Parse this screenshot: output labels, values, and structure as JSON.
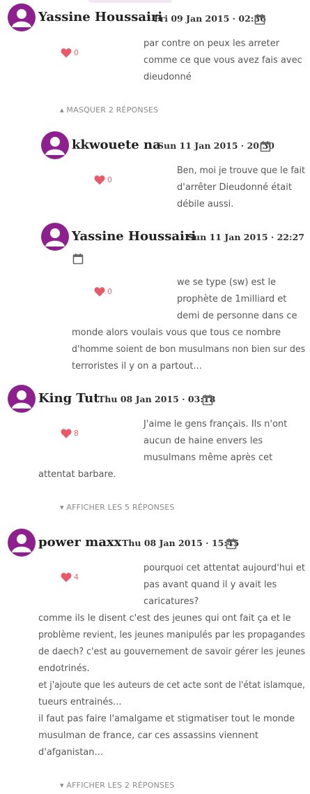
{
  "comments": [
    {
      "author": "Yassine Houssairi",
      "date": "Fri 09 Jan 2015 · 02:36",
      "likes": "0",
      "lines": [
        "par contre on peux les arreter",
        "comme ce que vous avez fais avec",
        "dieudonné"
      ],
      "toggle": "▴ MASQUER 2 RÉPONSES"
    },
    {
      "author": "kkwouete na",
      "date": "Sun 11 Jan 2015 · 20:30",
      "likes": "0",
      "lines": [
        "Ben, moi je trouve que le fait",
        "d'arrêter Dieudonné était",
        "débile aussi."
      ]
    },
    {
      "author": "Yassine Houssairi",
      "date": "Sun 11 Jan 2015 · 22:27",
      "likes": "0",
      "lines": [
        "we se type (sw) est le",
        "prophète de 1milliard et",
        "demi de personne dans ce",
        "monde alors voulais vous que tous ce nombre",
        "d'homme soient de bon musulmans non bien sur des",
        "terroristes il y on a partout..."
      ]
    },
    {
      "author": "King Tut",
      "date": "Thu 08 Jan 2015 · 03:18",
      "likes": "8",
      "lines": [
        "J'aime le gens français. Ils n'ont",
        "aucun de haine envers les",
        "musulmans même après cet",
        "attentat barbare."
      ],
      "toggle": "▾ AFFICHER LES 5 RÉPONSES"
    },
    {
      "author": "power maxx",
      "date": "Thu 08 Jan 2015 · 15:45",
      "likes": "4",
      "lines": [
        "pourquoi cet attentat aujourd'hui et",
        "pas avant quand il y avait les",
        "caricatures?",
        "comme ils le disent c'est des jeunes qui ont fait ça et le",
        "problème revient, les jeunes manipulés par les propagandes",
        "de daech? c'est au gouvernement de savoir gérer les jeunes",
        "endotrinés.",
        "et j'ajoute que les auteurs de cet acte sont de l'état islamque,",
        "tueurs entrainés...",
        "il faut pas faire l'amalgame et stigmatiser tout le monde",
        "musulman de france, car ces assassins viennent",
        "d'afganistan..."
      ],
      "toggle": "▾ AFFICHER LES 2 RÉPONSES"
    }
  ],
  "colors": {
    "avatar": "#8e1f8e",
    "heart": "#e85a6a"
  }
}
